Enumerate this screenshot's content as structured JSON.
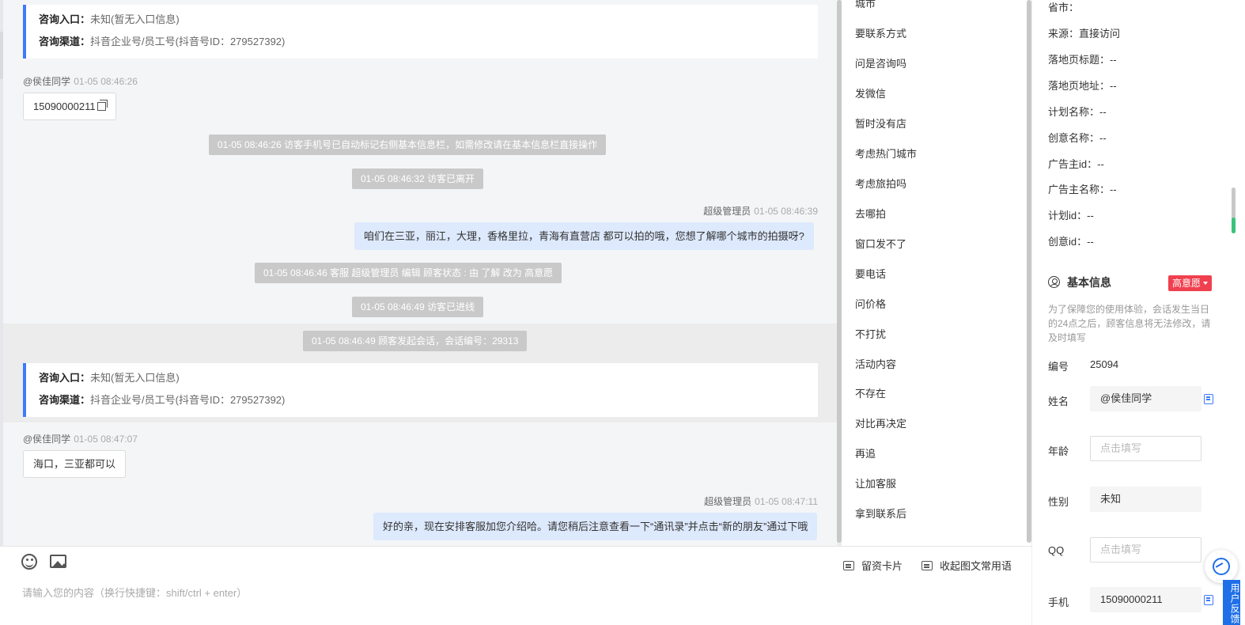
{
  "chat": {
    "info_card_1": {
      "entry_label": "咨询入口：",
      "entry_value": "未知(暂无入口信息)",
      "channel_label": "咨询渠道：",
      "channel_value": "抖音企业号/员工号(抖音号ID：279527392)"
    },
    "msg1": {
      "sender": "@侯佳同学",
      "time": "01-05 08:46:26",
      "text": "15090000211"
    },
    "sys1": "01-05 08:46:26 访客手机号已自动标记右侧基本信息栏，如需修改请在基本信息栏直接操作",
    "sys2": "01-05 08:46:32 访客已离开",
    "msg2": {
      "sender": "超级管理员",
      "time": "01-05 08:46:39",
      "text": "咱们在三亚，丽江，大理，香格里拉，青海有直营店 都可以拍的哦，您想了解哪个城市的拍摄呀?"
    },
    "sys3": "01-05 08:46:46 客服 超级管理员 编辑 顾客状态 : 由 了解 改为 高意愿",
    "sys4": "01-05 08:46:49 访客已进线",
    "sys5": "01-05 08:46:49 顾客发起会话，会话编号：29313",
    "info_card_2": {
      "entry_label": "咨询入口：",
      "entry_value": "未知(暂无入口信息)",
      "channel_label": "咨询渠道：",
      "channel_value": "抖音企业号/员工号(抖音号ID：279527392)"
    },
    "msg3": {
      "sender": "@侯佳同学",
      "time": "01-05 08:47:07",
      "text": "海口，三亚都可以"
    },
    "msg4": {
      "sender": "超级管理员",
      "time": "01-05 08:47:11",
      "text": "好的亲，现在安排客服加您介绍哈。请您稍后注意查看一下“通讯录”并点击“新的朋友”通过下哦"
    }
  },
  "composer": {
    "emoji_icon": "smile-icon",
    "image_icon": "image-icon",
    "placeholder": "请输入您的内容（换行快捷键：shift/ctrl + enter）",
    "lead_card_label": "留资卡片",
    "collapse_label": "收起图文常用语"
  },
  "quick_replies": [
    "城市",
    "要联系方式",
    "问是咨询吗",
    "发微信",
    "暂时没有店",
    "考虑热门城市",
    "考虑旅拍吗",
    "去哪拍",
    "窗口发不了",
    "要电话",
    "问价格",
    "不打扰",
    "活动内容",
    "不存在",
    "对比再决定",
    "再追",
    "让加客服",
    "拿到联系后"
  ],
  "customer": {
    "source_info": [
      "省市：",
      "来源：直接访问",
      "落地页标题：--",
      "落地页地址：--",
      "计划名称：--",
      "创意名称：--",
      "广告主id：--",
      "广告主名称：--",
      "计划id：--",
      "创意id：--"
    ],
    "basic_title": "基本信息",
    "intent_badge": "高意愿",
    "notice": "为了保障您的使用体验，会话发生当日的24点之后，顾客信息将无法修改，请及时填写",
    "id_label": "编号",
    "id_value": "25094",
    "name_label": "姓名",
    "name_value": "@侯佳同学",
    "age_label": "年龄",
    "age_placeholder": "点击填写",
    "gender_label": "性别",
    "gender_value": "未知",
    "qq_label": "QQ",
    "qq_placeholder": "点击填写",
    "phone_label": "手机",
    "phone_value": "15090000211",
    "feedback_label": "用户反馈"
  },
  "colors": {
    "accent": "#3e7bfa",
    "badge": "#f0404f",
    "bubble_agent": "#dde9fc",
    "system_msg": "#c9c9c9"
  }
}
